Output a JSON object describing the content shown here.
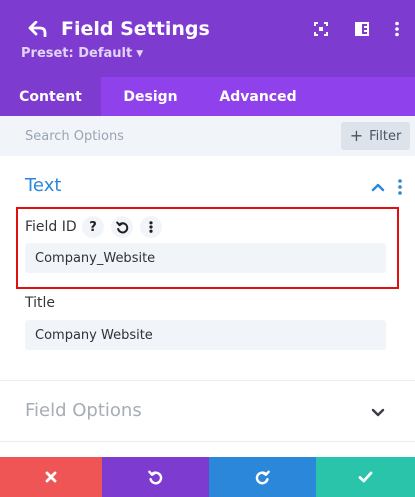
{
  "header": {
    "title": "Field Settings",
    "preset_label": "Preset: Default",
    "icons": [
      "back-arrow-icon",
      "expand-icon",
      "sidebar-toggle-icon",
      "more-vertical-icon"
    ],
    "bg_color": "#7e3bd0"
  },
  "tabs": [
    {
      "label": "Content",
      "active": true
    },
    {
      "label": "Design",
      "active": false
    },
    {
      "label": "Advanced",
      "active": false
    }
  ],
  "search": {
    "placeholder": "Search Options",
    "value": ""
  },
  "filter_button": {
    "label": "Filter"
  },
  "text_section": {
    "title": "Text",
    "expanded": true,
    "fields": {
      "field_id": {
        "label": "Field ID",
        "value": "Company_Website"
      },
      "title": {
        "label": "Title",
        "value": "Company Website"
      }
    }
  },
  "field_options_section": {
    "title": "Field Options",
    "expanded": false
  },
  "bottom_bar": [
    {
      "action": "discard",
      "icon": "close-icon",
      "color": "#ef5555"
    },
    {
      "action": "undo",
      "icon": "undo-icon",
      "color": "#7e3bd0"
    },
    {
      "action": "redo",
      "icon": "redo-icon",
      "color": "#2b87da"
    },
    {
      "action": "save",
      "icon": "check-icon",
      "color": "#29c4a9"
    }
  ],
  "colors": {
    "accent_blue": "#2b87da",
    "highlight_red": "#e01010",
    "field_bg": "#f1f5f9"
  }
}
